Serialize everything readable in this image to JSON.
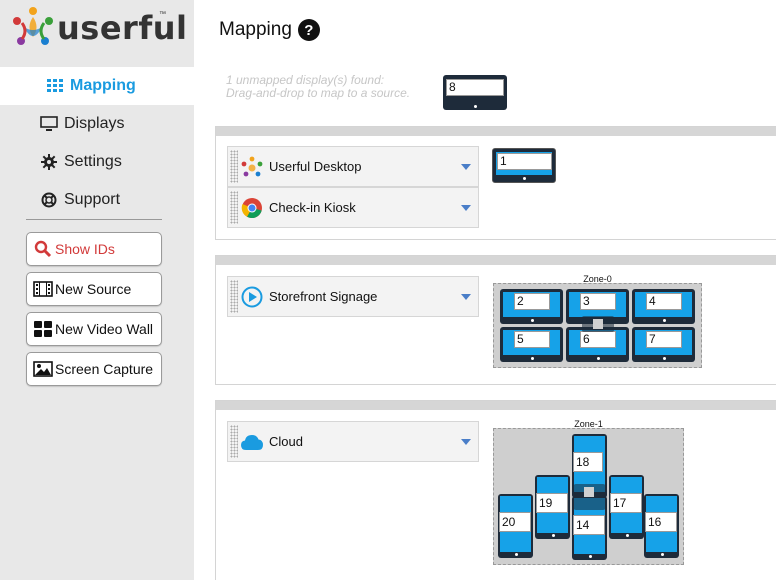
{
  "brand": {
    "name": "userful",
    "tm": "™"
  },
  "nav": [
    {
      "label": "Mapping",
      "icon": "grid-icon",
      "active": true
    },
    {
      "label": "Displays",
      "icon": "monitor-icon",
      "active": false
    },
    {
      "label": "Settings",
      "icon": "gear-icon",
      "active": false
    },
    {
      "label": "Support",
      "icon": "lifebuoy-icon",
      "active": false
    }
  ],
  "actions": [
    {
      "label": "Show IDs",
      "icon": "search-icon"
    },
    {
      "label": "New Source",
      "icon": "film-icon"
    },
    {
      "label": "New Video Wall",
      "icon": "grid-icon"
    },
    {
      "label": "Screen Capture",
      "icon": "image-icon"
    }
  ],
  "page": {
    "title": "Mapping",
    "help": "?"
  },
  "unmapped": {
    "line1": "1 unmapped display(s) found:",
    "line2": "Drag-and-drop to map to a source.",
    "display_id": "8"
  },
  "groups": [
    {
      "sources": [
        {
          "label": "Userful Desktop",
          "icon": "userful-icon"
        },
        {
          "label": "Check-in Kiosk",
          "icon": "chrome-icon"
        }
      ],
      "displays": [
        "1"
      ]
    },
    {
      "sources": [
        {
          "label": "Storefront Signage",
          "icon": "play-icon"
        }
      ],
      "zone": "Zone-0",
      "displays": [
        "2",
        "3",
        "4",
        "5",
        "6",
        "7"
      ]
    },
    {
      "sources": [
        {
          "label": "Cloud",
          "icon": "cloud-icon"
        }
      ],
      "zone": "Zone-1",
      "displays": [
        "18",
        "19",
        "17",
        "20",
        "14",
        "16"
      ]
    }
  ],
  "colors": {
    "accent": "#1a9be0",
    "screen": "#16a2e8",
    "bezel": "#1e2b3a",
    "danger": "#d23a3a"
  }
}
